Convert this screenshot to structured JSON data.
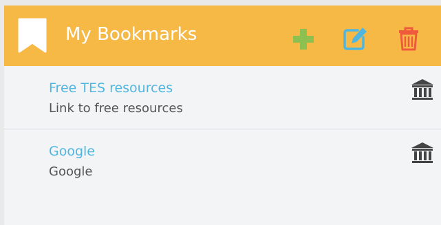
{
  "header": {
    "title": "My Bookmarks",
    "icons": {
      "bookmark": "bookmark-icon",
      "add": "plus-icon",
      "edit": "edit-icon",
      "delete": "trash-icon"
    },
    "colors": {
      "background": "#f6b945",
      "add": "#8cc152",
      "edit": "#4fb6e0",
      "delete": "#f05a3c"
    }
  },
  "bookmarks": [
    {
      "title": "Free TES resources",
      "description": "Link to free resources",
      "icon": "bank-icon"
    },
    {
      "title": "Google",
      "description": "Google",
      "icon": "bank-icon"
    }
  ],
  "colors": {
    "link": "#4fb6e0",
    "text": "#545454",
    "icon": "#444444"
  }
}
